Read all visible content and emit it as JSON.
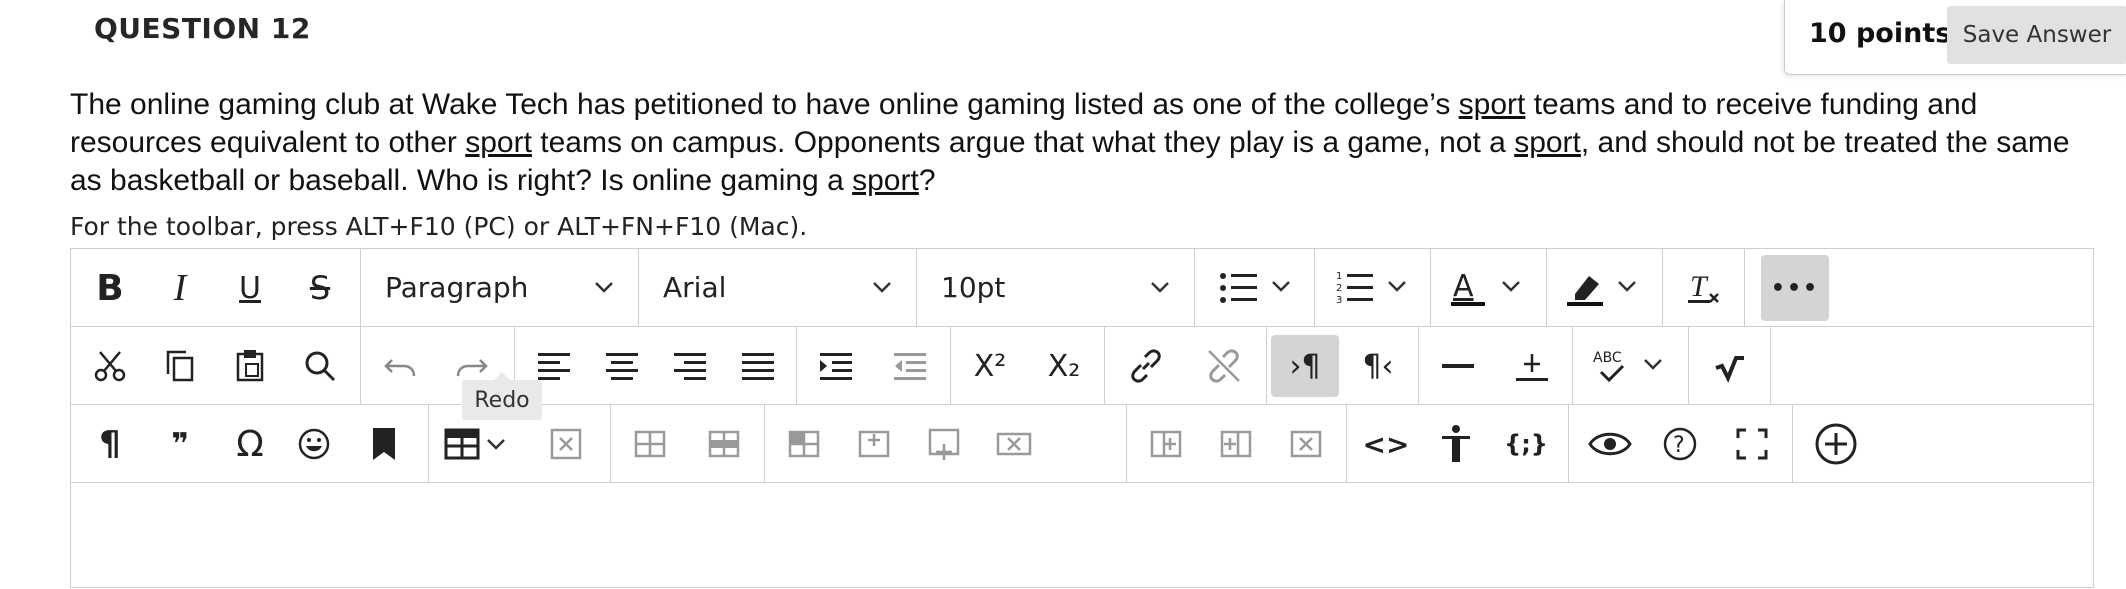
{
  "question": {
    "title": "QUESTION 12",
    "points": "10 points",
    "save_label": "Save Answer",
    "prompt_parts": [
      "The online gaming club at Wake Tech has petitioned to have online gaming listed as one of the college’s ",
      "sport",
      " teams and to receive funding and resources equivalent to other ",
      "sport",
      " teams on campus. Opponents argue that what they play is a game, not a ",
      "sport",
      ", and should not be treated the same as basketball or baseball. Who is right? Is online gaming a ",
      "sport",
      "?"
    ],
    "toolbar_hint": "For the toolbar, press ALT+F10 (PC) or ALT+FN+F10 (Mac)."
  },
  "editor": {
    "block_format": "Paragraph",
    "font_family": "Arial",
    "font_size": "10pt",
    "tooltip": "Redo",
    "icons": {
      "bold": "B",
      "italic": "I",
      "underline": "U",
      "strike": "S",
      "more": "•••",
      "superscript": "X²",
      "subscript": "X₂",
      "pilcrow": "¶",
      "quote": "❞",
      "omega": "Ω",
      "code": "<>",
      "source": "{;}",
      "help": "?",
      "spell": "ABC"
    },
    "colors": {
      "active_bg": "#d2d4d6",
      "border": "#cfcfcf"
    }
  }
}
